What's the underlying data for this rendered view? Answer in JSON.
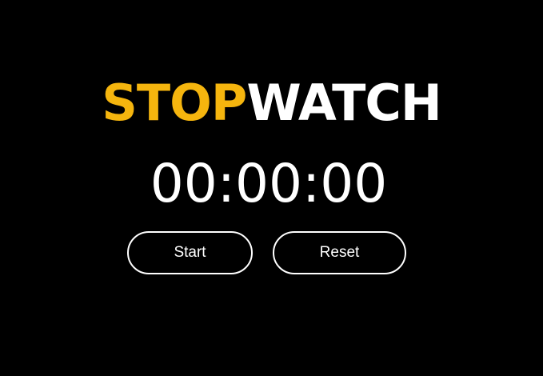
{
  "title": {
    "accent": "STOP",
    "main": "WATCH"
  },
  "timer": {
    "display": "00:00:00"
  },
  "controls": {
    "start_label": "Start",
    "reset_label": "Reset"
  },
  "colors": {
    "background": "#000000",
    "accent": "#F5B50E",
    "text": "#FFFFFF"
  }
}
